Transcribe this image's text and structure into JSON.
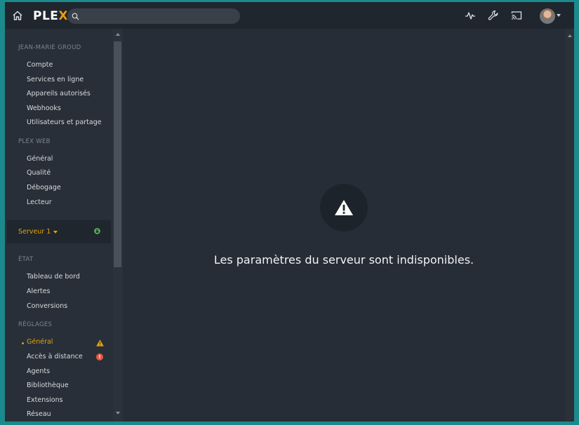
{
  "app": {
    "logo_main": "PLE",
    "logo_accent": "X"
  },
  "search": {
    "value": "",
    "placeholder": ""
  },
  "topbar_icons": [
    "home-icon",
    "activity-icon",
    "wrench-icon",
    "cast-icon"
  ],
  "sidebar": {
    "account_header": "JEAN-MARIE GROUD",
    "account_items": [
      "Compte",
      "Services en ligne",
      "Appareils autorisés",
      "Webhooks",
      "Utilisateurs et partage"
    ],
    "web_header": "PLEX WEB",
    "web_items": [
      "Général",
      "Qualité",
      "Débogage",
      "Lecteur"
    ],
    "server_label": "Serveur 1",
    "state_header": "ÉTAT",
    "state_items": [
      "Tableau de bord",
      "Alertes",
      "Conversions"
    ],
    "settings_header": "RÉGLAGES",
    "settings_items": [
      "Général",
      "Accès à distance",
      "Agents",
      "Bibliothèque",
      "Extensions",
      "Réseau"
    ],
    "active_item": "Général"
  },
  "main": {
    "message": "Les paramètres du serveur sont indisponibles."
  },
  "colors": {
    "accent": "#e5a00d",
    "warning": "#e5a00d",
    "error": "#e8573f",
    "online": "#5cb85c"
  }
}
